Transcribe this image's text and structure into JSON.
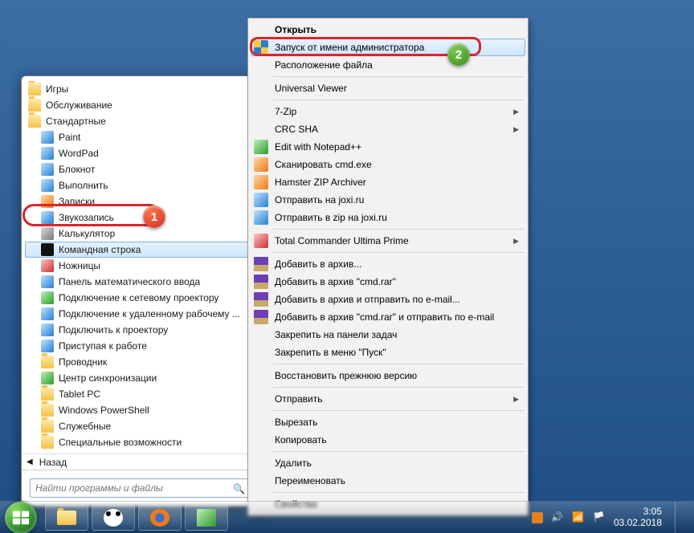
{
  "start_menu": {
    "folders_top": [
      {
        "label": "Игры"
      },
      {
        "label": "Обслуживание"
      },
      {
        "label": "Стандартные"
      }
    ],
    "items": [
      {
        "label": "Paint",
        "icon": "paint"
      },
      {
        "label": "WordPad",
        "icon": "wordpad"
      },
      {
        "label": "Блокнот",
        "icon": "notepad"
      },
      {
        "label": "Выполнить",
        "icon": "run"
      },
      {
        "label": "Записки",
        "icon": "sticky"
      },
      {
        "label": "Звукозапись",
        "icon": "sound"
      },
      {
        "label": "Калькулятор",
        "icon": "calc"
      },
      {
        "label": "Командная строка",
        "icon": "cmd",
        "highlight": true
      },
      {
        "label": "Ножницы",
        "icon": "snip"
      },
      {
        "label": "Панель математического ввода",
        "icon": "math"
      },
      {
        "label": "Подключение к сетевому проектору",
        "icon": "proj-net"
      },
      {
        "label": "Подключение к удаленному рабочему ...",
        "icon": "rdp"
      },
      {
        "label": "Подключить к проектору",
        "icon": "proj"
      },
      {
        "label": "Приступая к работе",
        "icon": "getting"
      },
      {
        "label": "Проводник",
        "icon": "explorer"
      },
      {
        "label": "Центр синхронизации",
        "icon": "sync"
      }
    ],
    "folders_bottom": [
      {
        "label": "Tablet PC"
      },
      {
        "label": "Windows PowerShell"
      },
      {
        "label": "Служебные"
      },
      {
        "label": "Специальные возможности"
      }
    ],
    "back_label": "Назад",
    "search_placeholder": "Найти программы и файлы"
  },
  "context_menu": {
    "groups": [
      [
        {
          "label": "Открыть",
          "bold": true
        },
        {
          "label": "Запуск от имени администратора",
          "icon": "shield",
          "hover": true
        },
        {
          "label": "Расположение файла"
        }
      ],
      [
        {
          "label": "Universal Viewer"
        }
      ],
      [
        {
          "label": "7-Zip",
          "submenu": true
        },
        {
          "label": "CRC SHA",
          "submenu": true
        },
        {
          "label": "Edit with Notepad++",
          "icon": "npp"
        },
        {
          "label": "Сканировать cmd.exe",
          "icon": "avast"
        },
        {
          "label": "Hamster ZIP Archiver",
          "icon": "hamster"
        },
        {
          "label": "Отправить на joxi.ru",
          "icon": "joxi"
        },
        {
          "label": "Отправить в zip на joxi.ru",
          "icon": "joxi"
        }
      ],
      [
        {
          "label": "Total Commander Ultima Prime",
          "icon": "tc",
          "submenu": true
        }
      ],
      [
        {
          "label": "Добавить в архив...",
          "icon": "winrar"
        },
        {
          "label": "Добавить в архив \"cmd.rar\"",
          "icon": "winrar"
        },
        {
          "label": "Добавить в архив и отправить по e-mail...",
          "icon": "winrar"
        },
        {
          "label": "Добавить в архив \"cmd.rar\" и отправить по e-mail",
          "icon": "winrar"
        },
        {
          "label": "Закрепить на панели задач"
        },
        {
          "label": "Закрепить в меню \"Пуск\""
        }
      ],
      [
        {
          "label": "Восстановить прежнюю версию"
        }
      ],
      [
        {
          "label": "Отправить",
          "submenu": true
        }
      ],
      [
        {
          "label": "Вырезать"
        },
        {
          "label": "Копировать"
        }
      ],
      [
        {
          "label": "Удалить"
        },
        {
          "label": "Переименовать"
        }
      ],
      [
        {
          "label": "Свойства"
        }
      ]
    ]
  },
  "badges": {
    "one": "1",
    "two": "2"
  },
  "taskbar": {
    "time": "3:05",
    "date": "03.02.2018"
  }
}
